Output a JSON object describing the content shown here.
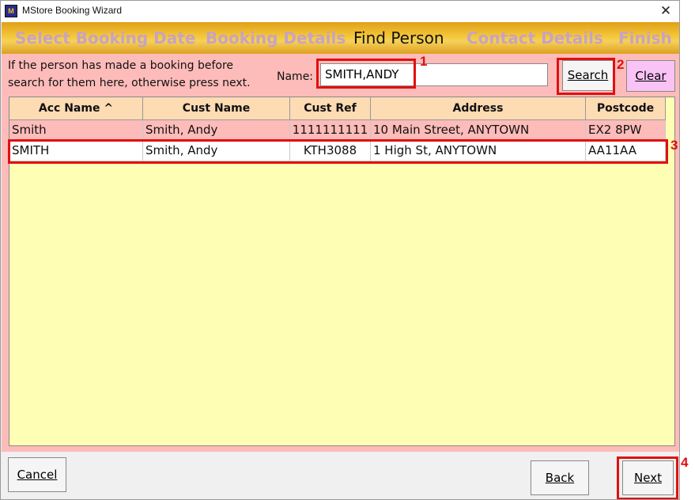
{
  "window": {
    "title": "MStore Booking Wizard",
    "icon_label": "MSB",
    "close_glyph": "✕"
  },
  "steps": [
    {
      "label": "Select Booking Date",
      "active": false
    },
    {
      "label": "Booking Details",
      "active": false
    },
    {
      "label": "Find Person",
      "active": true
    },
    {
      "label": "Contact Details",
      "active": false
    },
    {
      "label": "Finish",
      "active": false
    }
  ],
  "find": {
    "instructions_line1": "If the person has made a booking before",
    "instructions_line2": "search for them here, otherwise press next.",
    "name_label": "Name:",
    "name_value": "SMITH,ANDY",
    "search_label": "Search",
    "clear_label": "Clear"
  },
  "table": {
    "columns": [
      "Acc Name ^",
      "Cust Name",
      "Cust Ref",
      "Address",
      "Postcode"
    ],
    "rows": [
      [
        "Smith",
        "Smith, Andy",
        "1111111111",
        "10 Main Street, ANYTOWN",
        "EX2 8PW"
      ],
      [
        "SMITH",
        "Smith, Andy",
        "KTH3088",
        "1 High St, ANYTOWN",
        "AA11AA"
      ]
    ]
  },
  "footer": {
    "cancel_label": "Cancel",
    "back_label": "Back",
    "next_label": "Next"
  },
  "annotations": [
    "1",
    "2",
    "3",
    "4"
  ],
  "colors": {
    "highlight": "#e01010",
    "pane_bg": "#fdbcb9",
    "grid_bg": "#fefeb4",
    "header_bg": "#fddbb3",
    "clear_btn": "#f9c3f6",
    "step_inactive": "#c7a3c2"
  }
}
